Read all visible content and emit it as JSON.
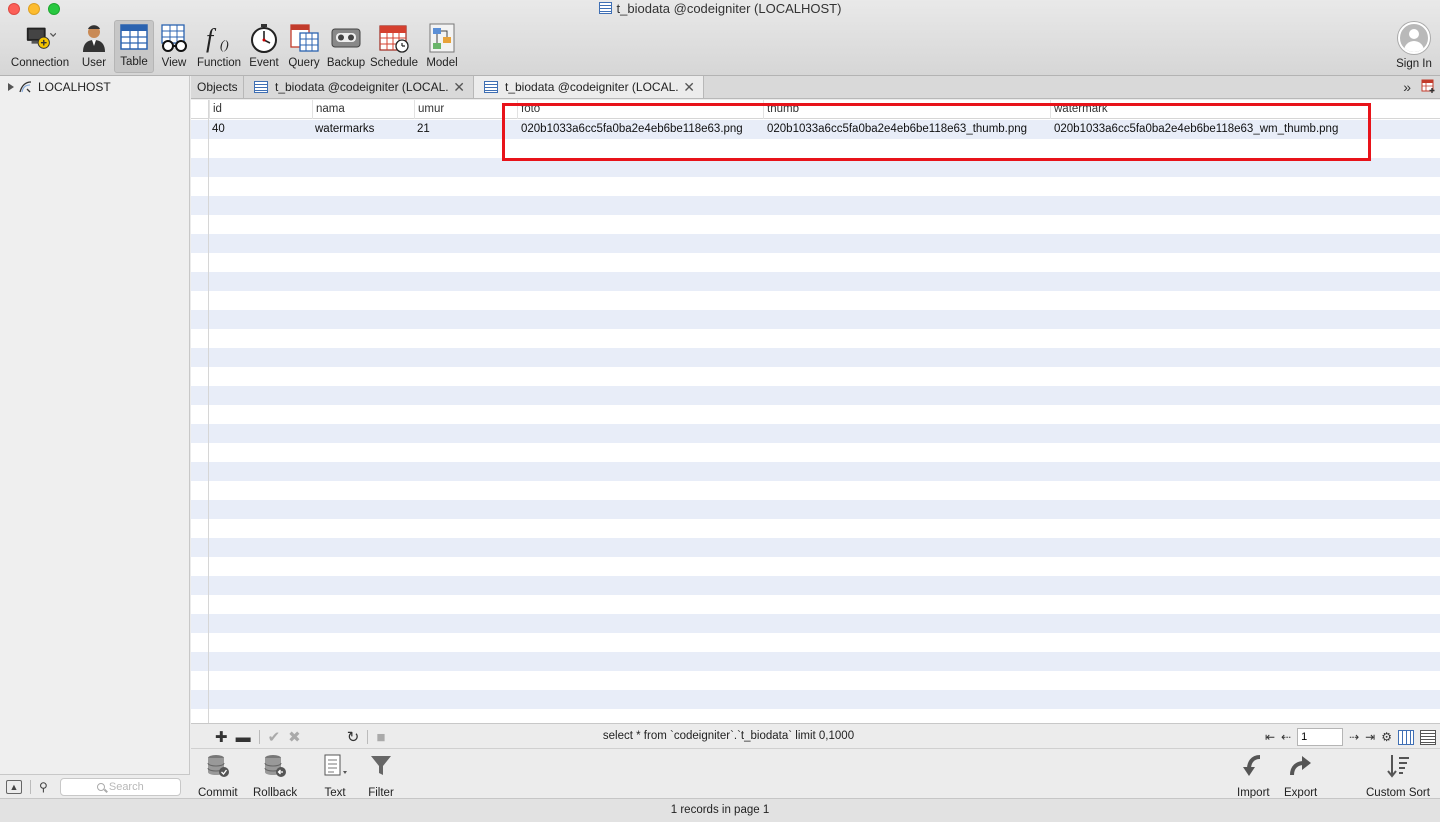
{
  "window": {
    "title": "t_biodata @codeigniter (LOCALHOST)"
  },
  "toolbar": {
    "items": [
      {
        "label": "Connection",
        "icon": "connection-icon"
      },
      {
        "label": "User",
        "icon": "user-icon"
      },
      {
        "label": "Table",
        "icon": "table-icon",
        "active": true
      },
      {
        "label": "View",
        "icon": "view-glasses-icon"
      },
      {
        "label": "Function",
        "icon": "function-icon"
      },
      {
        "label": "Event",
        "icon": "stopwatch-icon"
      },
      {
        "label": "Query",
        "icon": "query-icon"
      },
      {
        "label": "Backup",
        "icon": "backup-tape-icon"
      },
      {
        "label": "Schedule",
        "icon": "calendar-icon"
      },
      {
        "label": "Model",
        "icon": "model-icon"
      }
    ],
    "sign_in": "Sign In"
  },
  "sidebar": {
    "tree": [
      {
        "label": "LOCALHOST",
        "icon": "connection-tree-icon"
      }
    ],
    "search_placeholder": "Search"
  },
  "tabs": {
    "objects": "Objects",
    "items": [
      {
        "label": "t_biodata @codeigniter (LOCAL...",
        "active": false
      },
      {
        "label": "t_biodata @codeigniter (LOCAL...",
        "active": true
      }
    ]
  },
  "grid": {
    "columns": [
      "id",
      "nama",
      "umur",
      "foto",
      "thumb",
      "watermark"
    ],
    "rows": [
      [
        "40",
        "watermarks",
        "21",
        "020b1033a6cc5fa0ba2e4eb6be118e63.png",
        "020b1033a6cc5fa0ba2e4eb6be118e63_thumb.png",
        "020b1033a6cc5fa0ba2e4eb6be118e63_wm_thumb.png"
      ]
    ],
    "highlight_color": "#e8131a",
    "alt_row_color": "#e8edf8"
  },
  "gridbar": {
    "sql": "select * from `codeigniter`.`t_biodata` limit 0,1000",
    "page": "1"
  },
  "actions": {
    "left": [
      {
        "label": "Commit",
        "icon": "commit-db-icon"
      },
      {
        "label": "Rollback",
        "icon": "rollback-db-icon"
      },
      {
        "label": "Text",
        "icon": "text-document-icon"
      },
      {
        "label": "Filter",
        "icon": "filter-funnel-icon"
      }
    ],
    "right": [
      {
        "label": "Import",
        "icon": "import-arrow-icon"
      },
      {
        "label": "Export",
        "icon": "export-arrow-icon"
      },
      {
        "label": "Custom Sort",
        "icon": "custom-sort-icon"
      }
    ]
  },
  "status": {
    "text": "1 records in page 1"
  }
}
